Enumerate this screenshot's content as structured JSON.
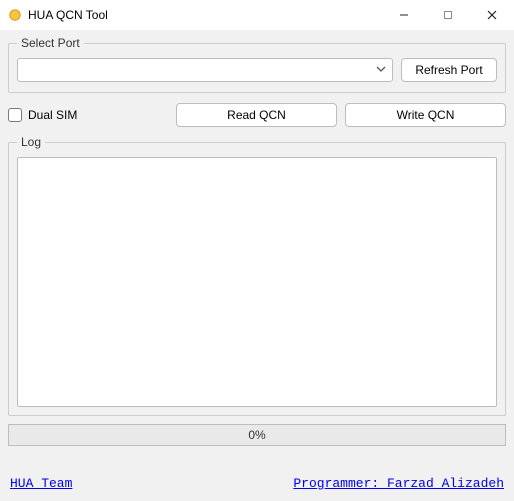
{
  "window": {
    "title": "HUA QCN Tool"
  },
  "port_group": {
    "legend": "Select Port",
    "selected": "",
    "refresh_label": "Refresh Port"
  },
  "dual_sim": {
    "label": "Dual SIM",
    "checked": false
  },
  "actions": {
    "read_label": "Read QCN",
    "write_label": "Write QCN"
  },
  "log_group": {
    "legend": "Log",
    "content": ""
  },
  "progress": {
    "text": "0%",
    "value": 0
  },
  "footer": {
    "team_label": "HUA Team",
    "programmer_label": "Programmer: Farzad Alizadeh"
  }
}
